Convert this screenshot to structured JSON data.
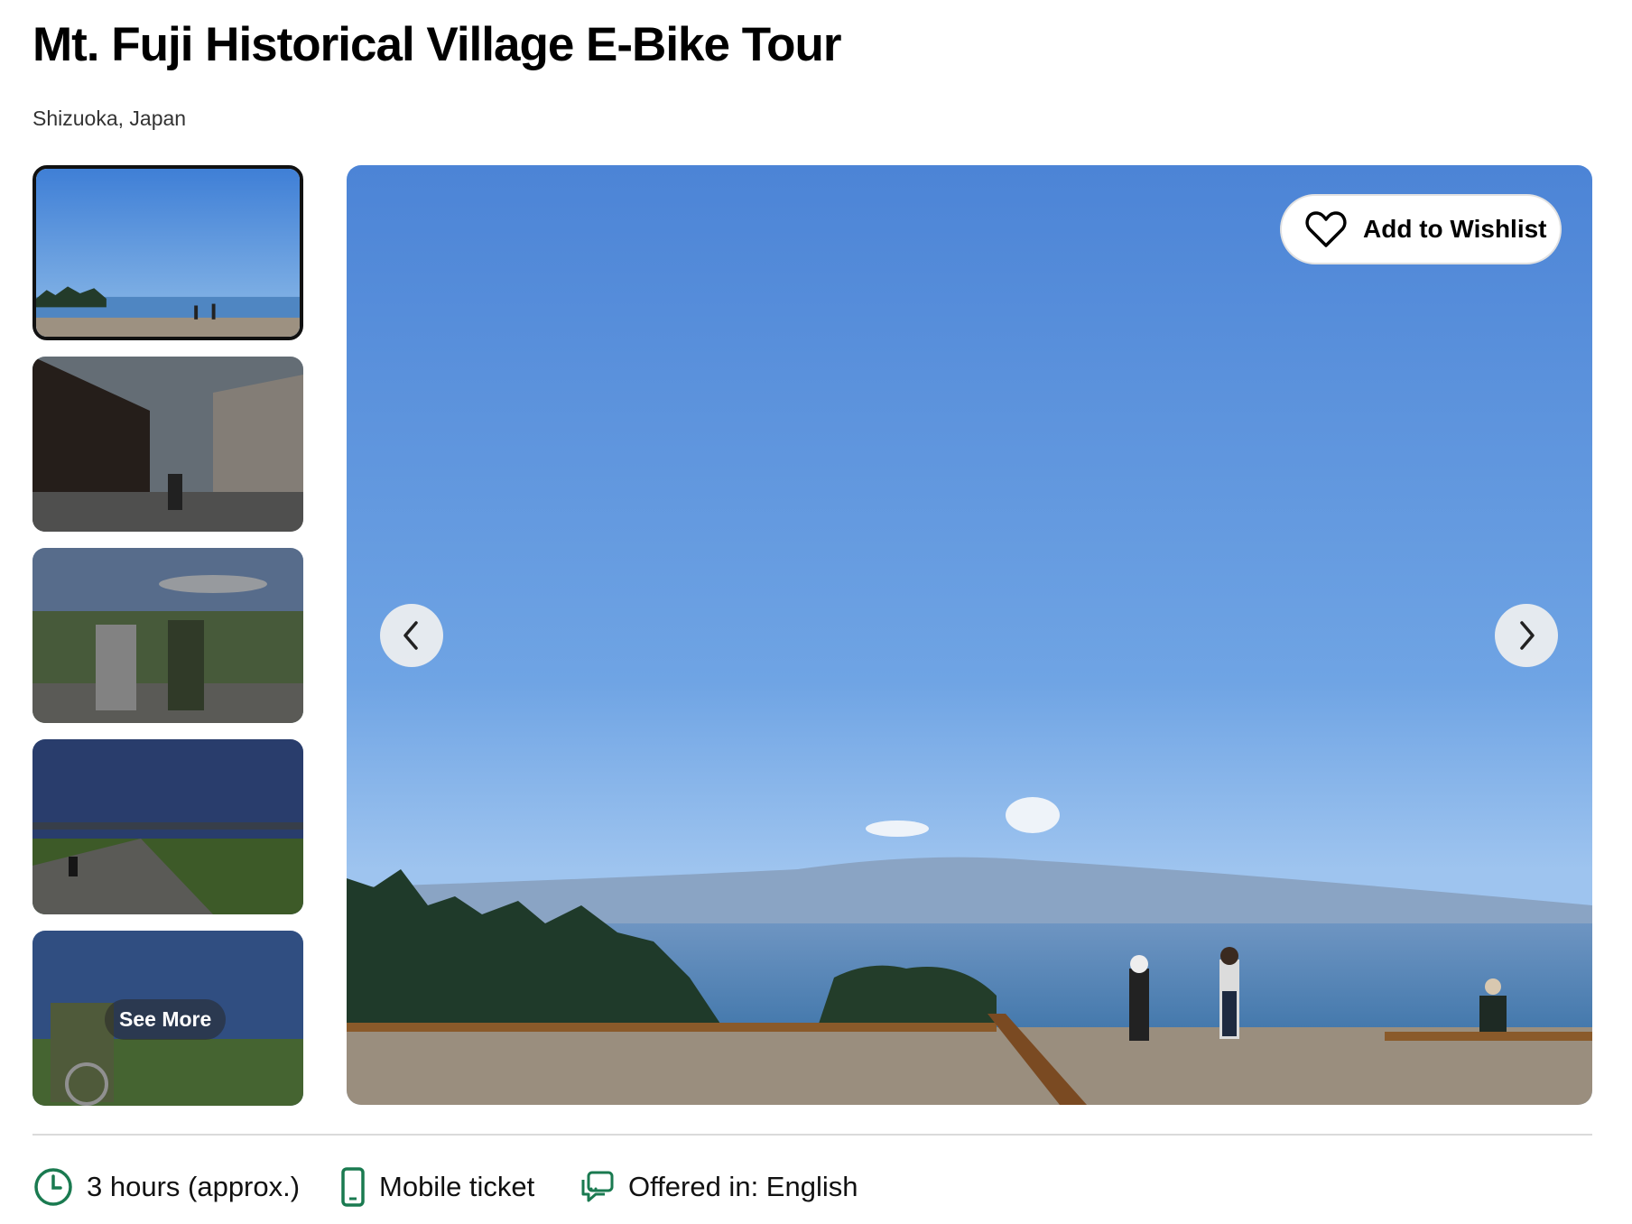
{
  "page": {
    "title": "Mt. Fuji Historical Village E-Bike Tour",
    "location": "Shizuoka, Japan"
  },
  "gallery": {
    "thumbnails": [
      {
        "scene": "coastal viewpoint",
        "selected": true
      },
      {
        "scene": "historic village street",
        "selected": false
      },
      {
        "scene": "cyclists by fields",
        "selected": false
      },
      {
        "scene": "riverside path with bridge",
        "selected": false
      },
      {
        "scene": "cyclists on hill",
        "selected": false
      }
    ],
    "see_more_label": "See More",
    "wishlist_label": "Add to Wishlist",
    "prev_icon": "chevron-left-icon",
    "next_icon": "chevron-right-icon"
  },
  "features": [
    {
      "icon": "clock-icon",
      "label": "3 hours (approx.)"
    },
    {
      "icon": "mobile-phone-icon",
      "label": "Mobile ticket"
    },
    {
      "icon": "chat-bubble-icon",
      "label": "Offered in: English"
    }
  ],
  "colors": {
    "accent_green": "#1a7a50",
    "text": "#000000",
    "divider": "#dadada"
  }
}
